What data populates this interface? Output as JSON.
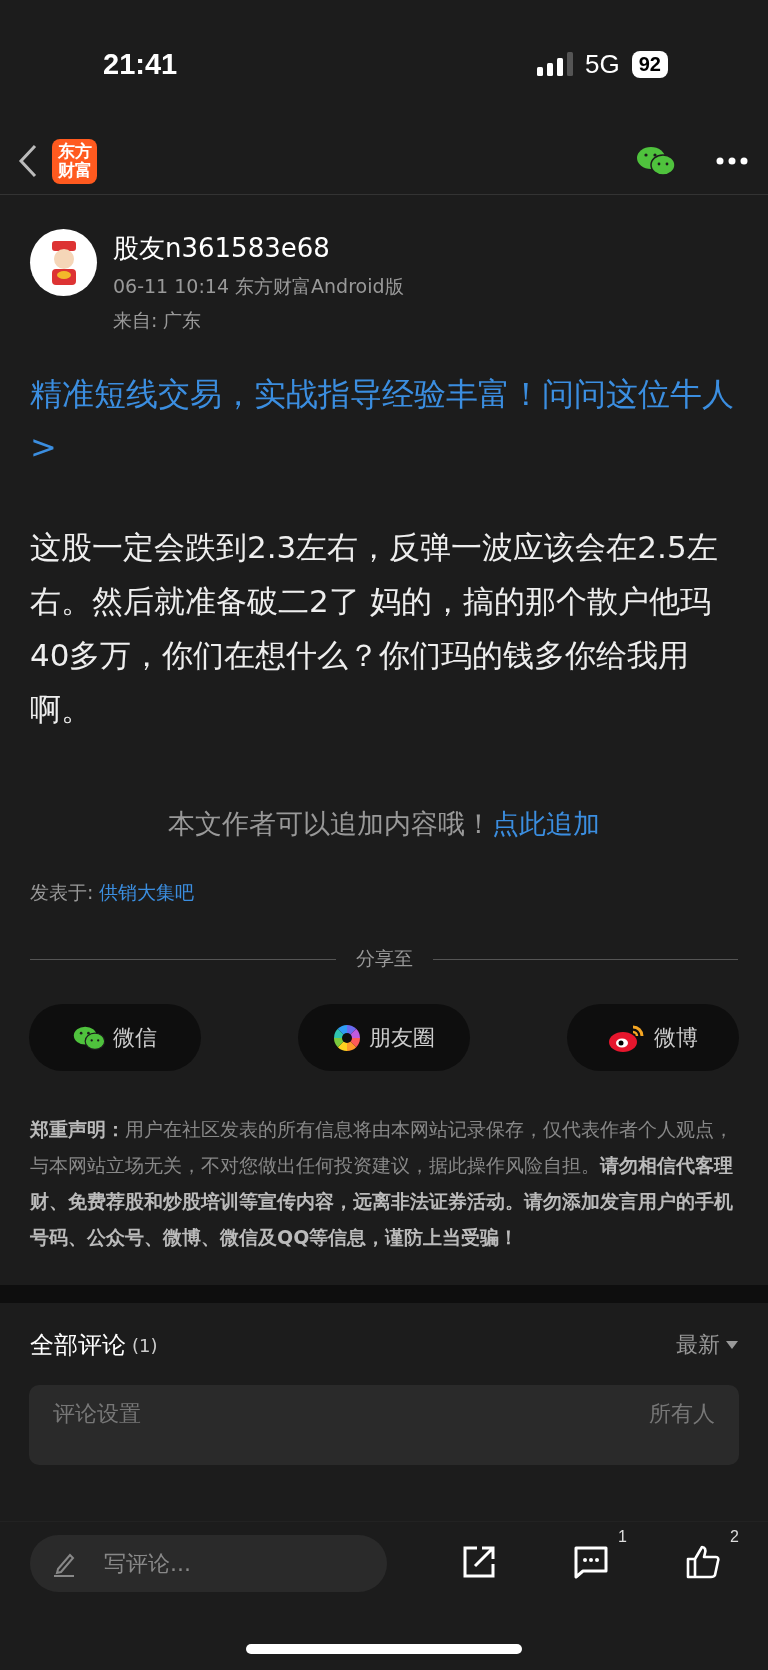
{
  "status_bar": {
    "time": "21:41",
    "network": "5G",
    "battery": "92"
  },
  "nav": {
    "logo": "东方财富"
  },
  "post": {
    "author": "股友n361583e68",
    "meta": "06-11 10:14 东方财富Android版",
    "location": "来自: 广东",
    "promo": "精准短线交易，实战指导经验丰富！问问这位牛人>",
    "body": "这股一定会跌到2.3左右，反弹一波应该会在2.5左右。然后就准备破二2了 妈的，搞的那个散户他玛40多万，你们在想什么？你们玛的钱多你给我用啊。",
    "add_note": "本文作者可以追加内容哦！",
    "add_link": "点此追加",
    "posted_in_label": "发表于:",
    "posted_in": "供销大集吧"
  },
  "share": {
    "title": "分享至",
    "buttons": [
      {
        "kind": "wechat",
        "label": "微信"
      },
      {
        "kind": "moments",
        "label": "朋友圈"
      },
      {
        "kind": "weibo",
        "label": "微博"
      }
    ]
  },
  "disclaimer": "**郑重声明：**用户在社区发表的所有信息将由本网站记录保存，仅代表作者个人观点，与本网站立场无关，不对您做出任何投资建议，据此操作风险自担。**请勿相信代客理财、免费荐股和炒股培训等宣传内容，远离非法证券活动。请勿添加发言用户的手机号码、公众号、微博、微信及QQ等信息，谨防上当受骗！**",
  "comments": {
    "title": "全部评论",
    "count": "(1)",
    "sort": "最新",
    "settings_label": "评论设置",
    "settings_value": "所有人"
  },
  "bottom_bar": {
    "placeholder": "写评论...",
    "comment_count": "1",
    "like_count": "2"
  }
}
